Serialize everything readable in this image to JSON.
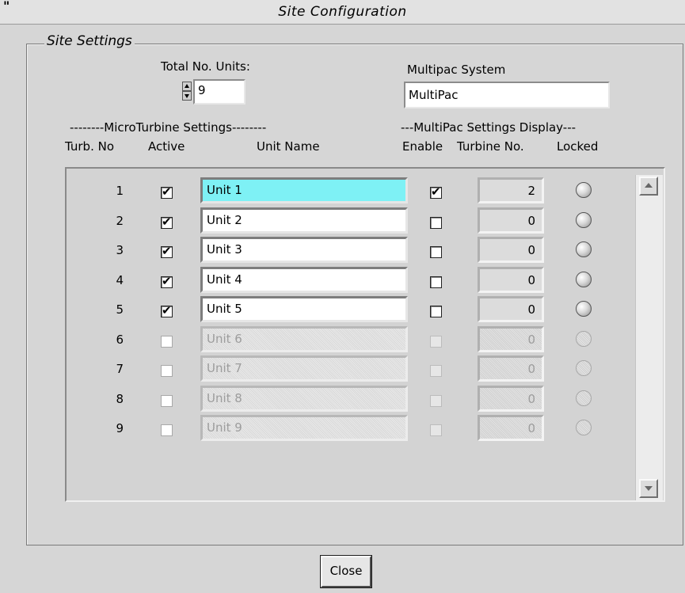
{
  "window": {
    "title": "Site Configuration",
    "corner_mark": "\""
  },
  "group": {
    "title": "Site Settings"
  },
  "total_units": {
    "label": "Total No. Units:",
    "value": "9"
  },
  "multipac_system": {
    "label": "Multipac System",
    "value": "MultiPac"
  },
  "headers": {
    "microturbine_section": "--------MicroTurbine  Settings--------",
    "multipac_section": "---MultiPac Settings Display---",
    "turb_no": "Turb. No",
    "active": "Active",
    "unit_name": "Unit Name",
    "enable": "Enable",
    "turbine_no": "Turbine No.",
    "locked": "Locked"
  },
  "rows": [
    {
      "turb_no": "1",
      "active": true,
      "unit_name": "Unit 1",
      "enable": true,
      "turbine_no": "2",
      "enabled_row": true,
      "selected": true
    },
    {
      "turb_no": "2",
      "active": true,
      "unit_name": "Unit 2",
      "enable": false,
      "turbine_no": "0",
      "enabled_row": true,
      "selected": false
    },
    {
      "turb_no": "3",
      "active": true,
      "unit_name": "Unit 3",
      "enable": false,
      "turbine_no": "0",
      "enabled_row": true,
      "selected": false
    },
    {
      "turb_no": "4",
      "active": true,
      "unit_name": "Unit 4",
      "enable": false,
      "turbine_no": "0",
      "enabled_row": true,
      "selected": false
    },
    {
      "turb_no": "5",
      "active": true,
      "unit_name": "Unit 5",
      "enable": false,
      "turbine_no": "0",
      "enabled_row": true,
      "selected": false
    },
    {
      "turb_no": "6",
      "active": false,
      "unit_name": "Unit 6",
      "enable": false,
      "turbine_no": "0",
      "enabled_row": false,
      "selected": false
    },
    {
      "turb_no": "7",
      "active": false,
      "unit_name": "Unit 7",
      "enable": false,
      "turbine_no": "0",
      "enabled_row": false,
      "selected": false
    },
    {
      "turb_no": "8",
      "active": false,
      "unit_name": "Unit 8",
      "enable": false,
      "turbine_no": "0",
      "enabled_row": false,
      "selected": false
    },
    {
      "turb_no": "9",
      "active": false,
      "unit_name": "Unit 9",
      "enable": false,
      "turbine_no": "0",
      "enabled_row": false,
      "selected": false
    }
  ],
  "colors": {
    "selected_name": "#7ef1f5",
    "panel": "#d6d6d6"
  },
  "buttons": {
    "close": "Close"
  }
}
